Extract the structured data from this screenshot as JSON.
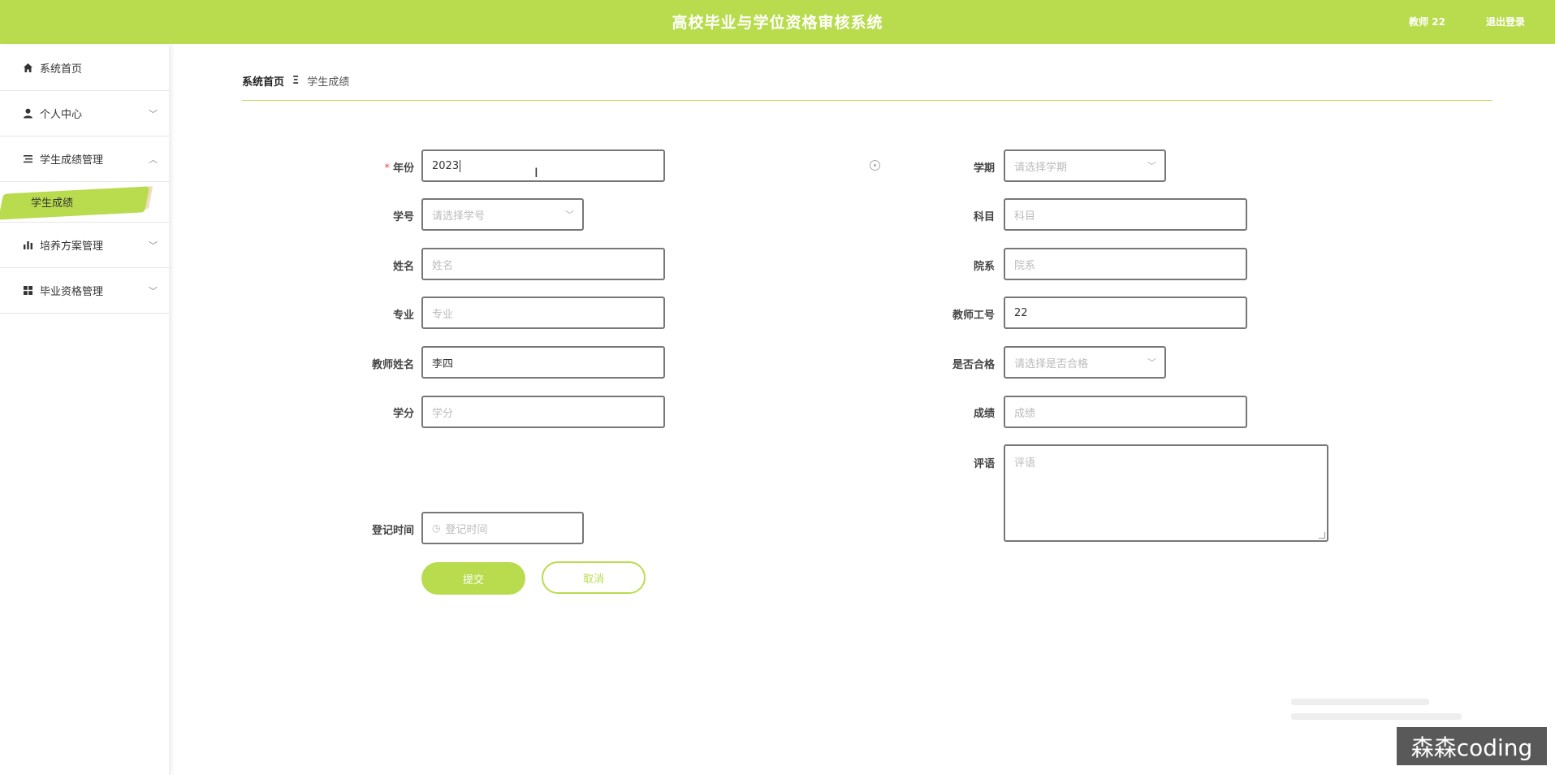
{
  "header": {
    "title": "高校毕业与学位资格审核系统",
    "user": "教师 22",
    "logout": "退出登录"
  },
  "sidebar": {
    "items": [
      {
        "label": "系统首页",
        "icon": "home-icon"
      },
      {
        "label": "个人中心",
        "icon": "person-icon"
      },
      {
        "label": "学生成绩管理",
        "icon": "list-icon"
      },
      {
        "label": "学生成绩",
        "icon": ""
      },
      {
        "label": "培养方案管理",
        "icon": "bar-chart-icon"
      },
      {
        "label": "毕业资格管理",
        "icon": "grid-icon"
      }
    ]
  },
  "breadcrumb": {
    "home": "系统首页",
    "separator": "Ξ",
    "current": "学生成绩"
  },
  "form": {
    "year": {
      "label": "年份",
      "value": "2023"
    },
    "semester": {
      "label": "学期",
      "placeholder": "请选择学期"
    },
    "student_no": {
      "label": "学号",
      "placeholder": "请选择学号"
    },
    "subject": {
      "label": "科目",
      "placeholder": "科目"
    },
    "name": {
      "label": "姓名",
      "placeholder": "姓名"
    },
    "department": {
      "label": "院系",
      "placeholder": "院系"
    },
    "major": {
      "label": "专业",
      "placeholder": "专业"
    },
    "teacher_no": {
      "label": "教师工号",
      "value": "22"
    },
    "teacher_name": {
      "label": "教师姓名",
      "value": "李四"
    },
    "qualified": {
      "label": "是否合格",
      "placeholder": "请选择是否合格"
    },
    "credit": {
      "label": "学分",
      "placeholder": "学分"
    },
    "score": {
      "label": "成绩",
      "placeholder": "成绩"
    },
    "comment": {
      "label": "评语",
      "placeholder": "评语"
    },
    "register_time": {
      "label": "登记时间",
      "placeholder": "登记时间"
    },
    "submit": "提交",
    "cancel": "取消"
  },
  "watermark": "森森coding",
  "colors": {
    "accent": "#b9dc4e"
  }
}
